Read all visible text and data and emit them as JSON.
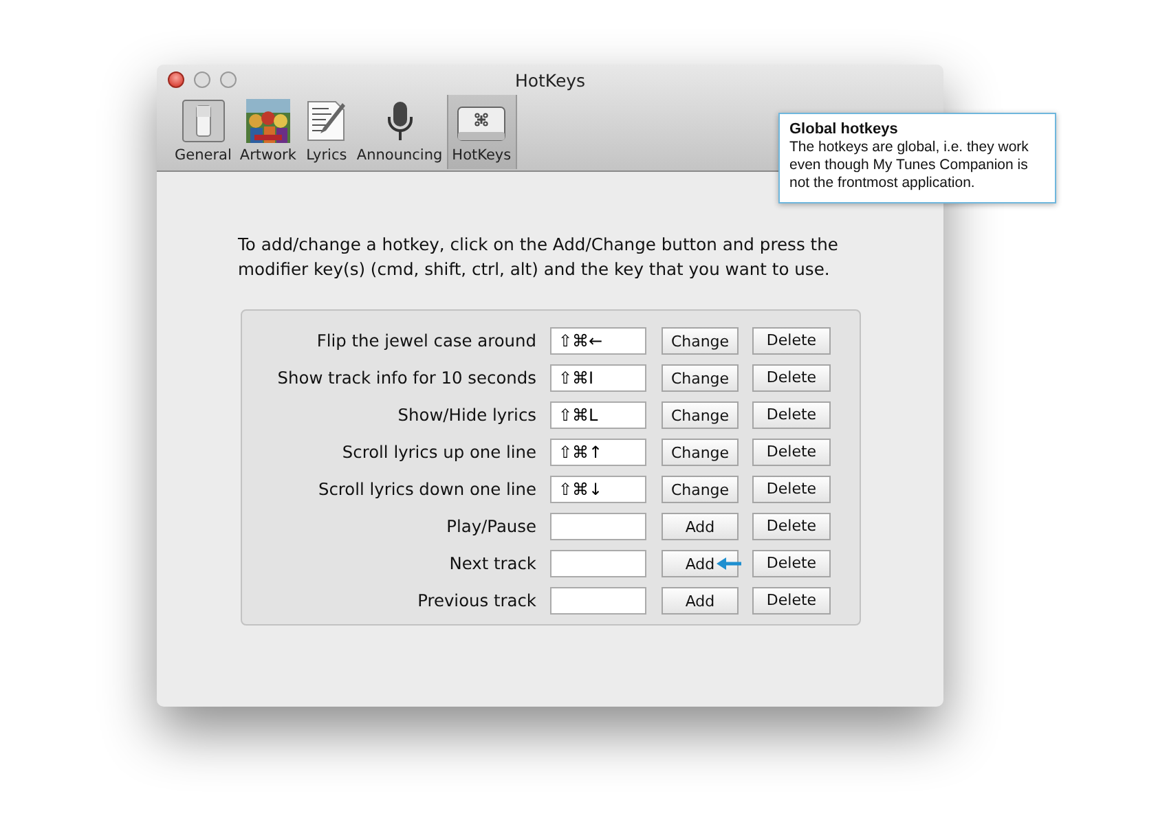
{
  "window": {
    "title": "HotKeys"
  },
  "tabs": [
    {
      "label": "General",
      "selected": false
    },
    {
      "label": "Artwork",
      "selected": false
    },
    {
      "label": "Lyrics",
      "selected": false
    },
    {
      "label": "Announcing",
      "selected": false
    },
    {
      "label": "HotKeys",
      "selected": true
    }
  ],
  "instructions": "To add/change a hotkey, click on the Add/Change button and press the modifier key(s) (cmd, shift, ctrl, alt) and the key that you want to use.",
  "hotkeys": [
    {
      "action": "Flip the jewel case around",
      "shortcut": "⇧⌘←",
      "button": "Change",
      "delete": "Delete"
    },
    {
      "action": "Show track info for 10 seconds",
      "shortcut": "⇧⌘I",
      "button": "Change",
      "delete": "Delete"
    },
    {
      "action": "Show/Hide lyrics",
      "shortcut": "⇧⌘L",
      "button": "Change",
      "delete": "Delete"
    },
    {
      "action": "Scroll lyrics up one line",
      "shortcut": "⇧⌘↑",
      "button": "Change",
      "delete": "Delete"
    },
    {
      "action": "Scroll lyrics down one line",
      "shortcut": "⇧⌘↓",
      "button": "Change",
      "delete": "Delete"
    },
    {
      "action": "Play/Pause",
      "button": "Add",
      "delete": "Delete"
    },
    {
      "action": "Next track",
      "button": "Add",
      "delete": "Delete"
    },
    {
      "action": "Previous track",
      "button": "Add",
      "delete": "Delete"
    }
  ],
  "tooltip": {
    "title": "Global hotkeys",
    "text": "The hotkeys are global, i.e. they work even though My Tunes Companion is not the frontmost application."
  }
}
